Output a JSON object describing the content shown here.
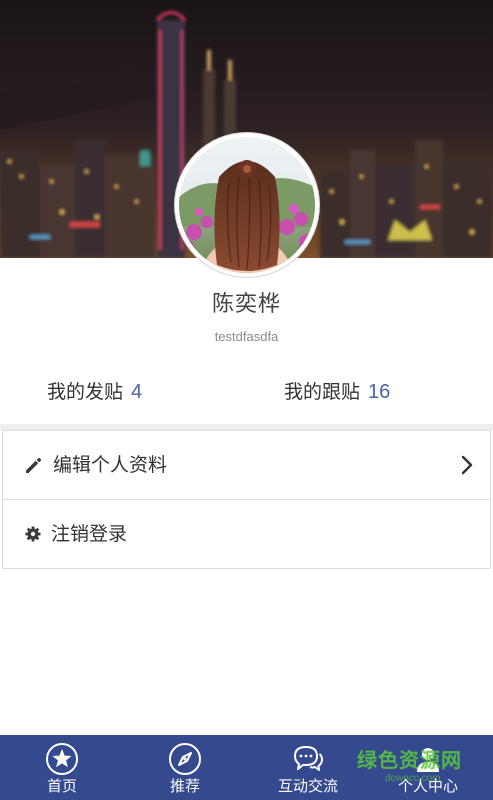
{
  "profile": {
    "name": "陈奕桦",
    "account": "testdfasdfa"
  },
  "stats": {
    "posts_label": "我的发贴",
    "posts_count": "4",
    "replies_label": "我的跟贴",
    "replies_count": "16"
  },
  "menu": {
    "edit_profile": "编辑个人资料",
    "logout": "注销登录"
  },
  "tabs": [
    {
      "label": "首页",
      "icon": "star-icon"
    },
    {
      "label": "推荐",
      "icon": "compass-icon"
    },
    {
      "label": "互动交流",
      "icon": "chat-icon"
    },
    {
      "label": "个人中心",
      "icon": "user-icon"
    }
  ],
  "watermark": {
    "text": "绿色资源网",
    "sub": "downcc.com"
  },
  "colors": {
    "tabbar": "#34498e",
    "count": "#4a62a8"
  }
}
